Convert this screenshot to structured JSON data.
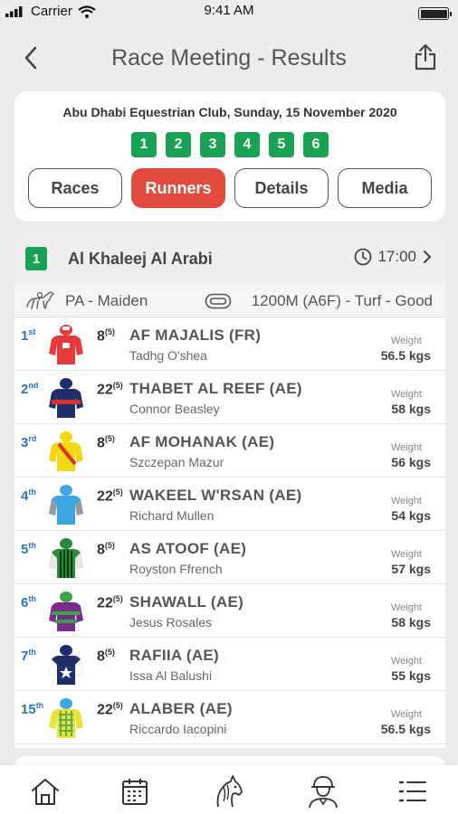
{
  "status_bar": {
    "carrier": "Carrier",
    "time": "9:41 AM"
  },
  "header": {
    "title": "Race Meeting - Results",
    "back_icon": "chevron-left-icon",
    "share_icon": "share-icon"
  },
  "meeting": {
    "info": "Abu Dhabi Equestrian Club, Sunday, 15 November 2020",
    "race_numbers": [
      "1",
      "2",
      "3",
      "4",
      "5",
      "6"
    ],
    "tabs": [
      {
        "label": "Races",
        "active": false
      },
      {
        "label": "Runners",
        "active": true
      },
      {
        "label": "Details",
        "active": false
      },
      {
        "label": "Media",
        "active": false
      }
    ]
  },
  "race": {
    "number": "1",
    "name": "Al Khaleej Al Arabi",
    "time": "17:00",
    "type": "PA - Maiden",
    "details": "1200M (A6F) - Turf - Good"
  },
  "runners": [
    {
      "place": "1",
      "place_suffix": "st",
      "number": "8",
      "draw": "(5)",
      "horse": "AF MAJALIS (FR)",
      "jockey": "Tadhg O'shea",
      "weight_label": "Weight",
      "weight": "56.5 kgs",
      "silk": "red-silk"
    },
    {
      "place": "2",
      "place_suffix": "nd",
      "number": "22",
      "draw": "(5)",
      "horse": "THABET AL REEF (AE)",
      "jockey": "Connor Beasley",
      "weight_label": "Weight",
      "weight": "58 kgs",
      "silk": "navy-red-silk"
    },
    {
      "place": "3",
      "place_suffix": "rd",
      "number": "8",
      "draw": "(5)",
      "horse": "AF MOHANAK (AE)",
      "jockey": "Szczepan Mazur",
      "weight_label": "Weight",
      "weight": "56 kgs",
      "silk": "yellow-red-sash-silk"
    },
    {
      "place": "4",
      "place_suffix": "th",
      "number": "22",
      "draw": "(5)",
      "horse": "WAKEEL W'RSAN (AE)",
      "jockey": "Richard Mullen",
      "weight_label": "Weight",
      "weight": "54 kgs",
      "silk": "light-blue-silk"
    },
    {
      "place": "5",
      "place_suffix": "th",
      "number": "8",
      "draw": "(5)",
      "horse": "AS ATOOF (AE)",
      "jockey": "Royston Ffrench",
      "weight_label": "Weight",
      "weight": "57 kgs",
      "silk": "green-stripe-silk"
    },
    {
      "place": "6",
      "place_suffix": "th",
      "number": "22",
      "draw": "(5)",
      "horse": "SHAWALL (AE)",
      "jockey": "Jesus Rosales",
      "weight_label": "Weight",
      "weight": "58 kgs",
      "silk": "purple-green-silk"
    },
    {
      "place": "7",
      "place_suffix": "th",
      "number": "8",
      "draw": "(5)",
      "horse": "RAFIIA (AE)",
      "jockey": "Issa Al Balushi",
      "weight_label": "Weight",
      "weight": "55 kgs",
      "silk": "navy-star-silk"
    },
    {
      "place": "15",
      "place_suffix": "th",
      "number": "22",
      "draw": "(5)",
      "horse": "ALABER (AE)",
      "jockey": "Riccardo Iacopini",
      "weight_label": "Weight",
      "weight": "56.5 kgs",
      "silk": "yellow-green-check-silk"
    }
  ],
  "bottom_nav": [
    "home-icon",
    "calendar-icon",
    "horse-head-icon",
    "jockey-icon",
    "menu-list-icon"
  ],
  "colors": {
    "accent_red": "#e14a3c",
    "race_green": "#17a254",
    "place_blue": "#2b73c7"
  }
}
